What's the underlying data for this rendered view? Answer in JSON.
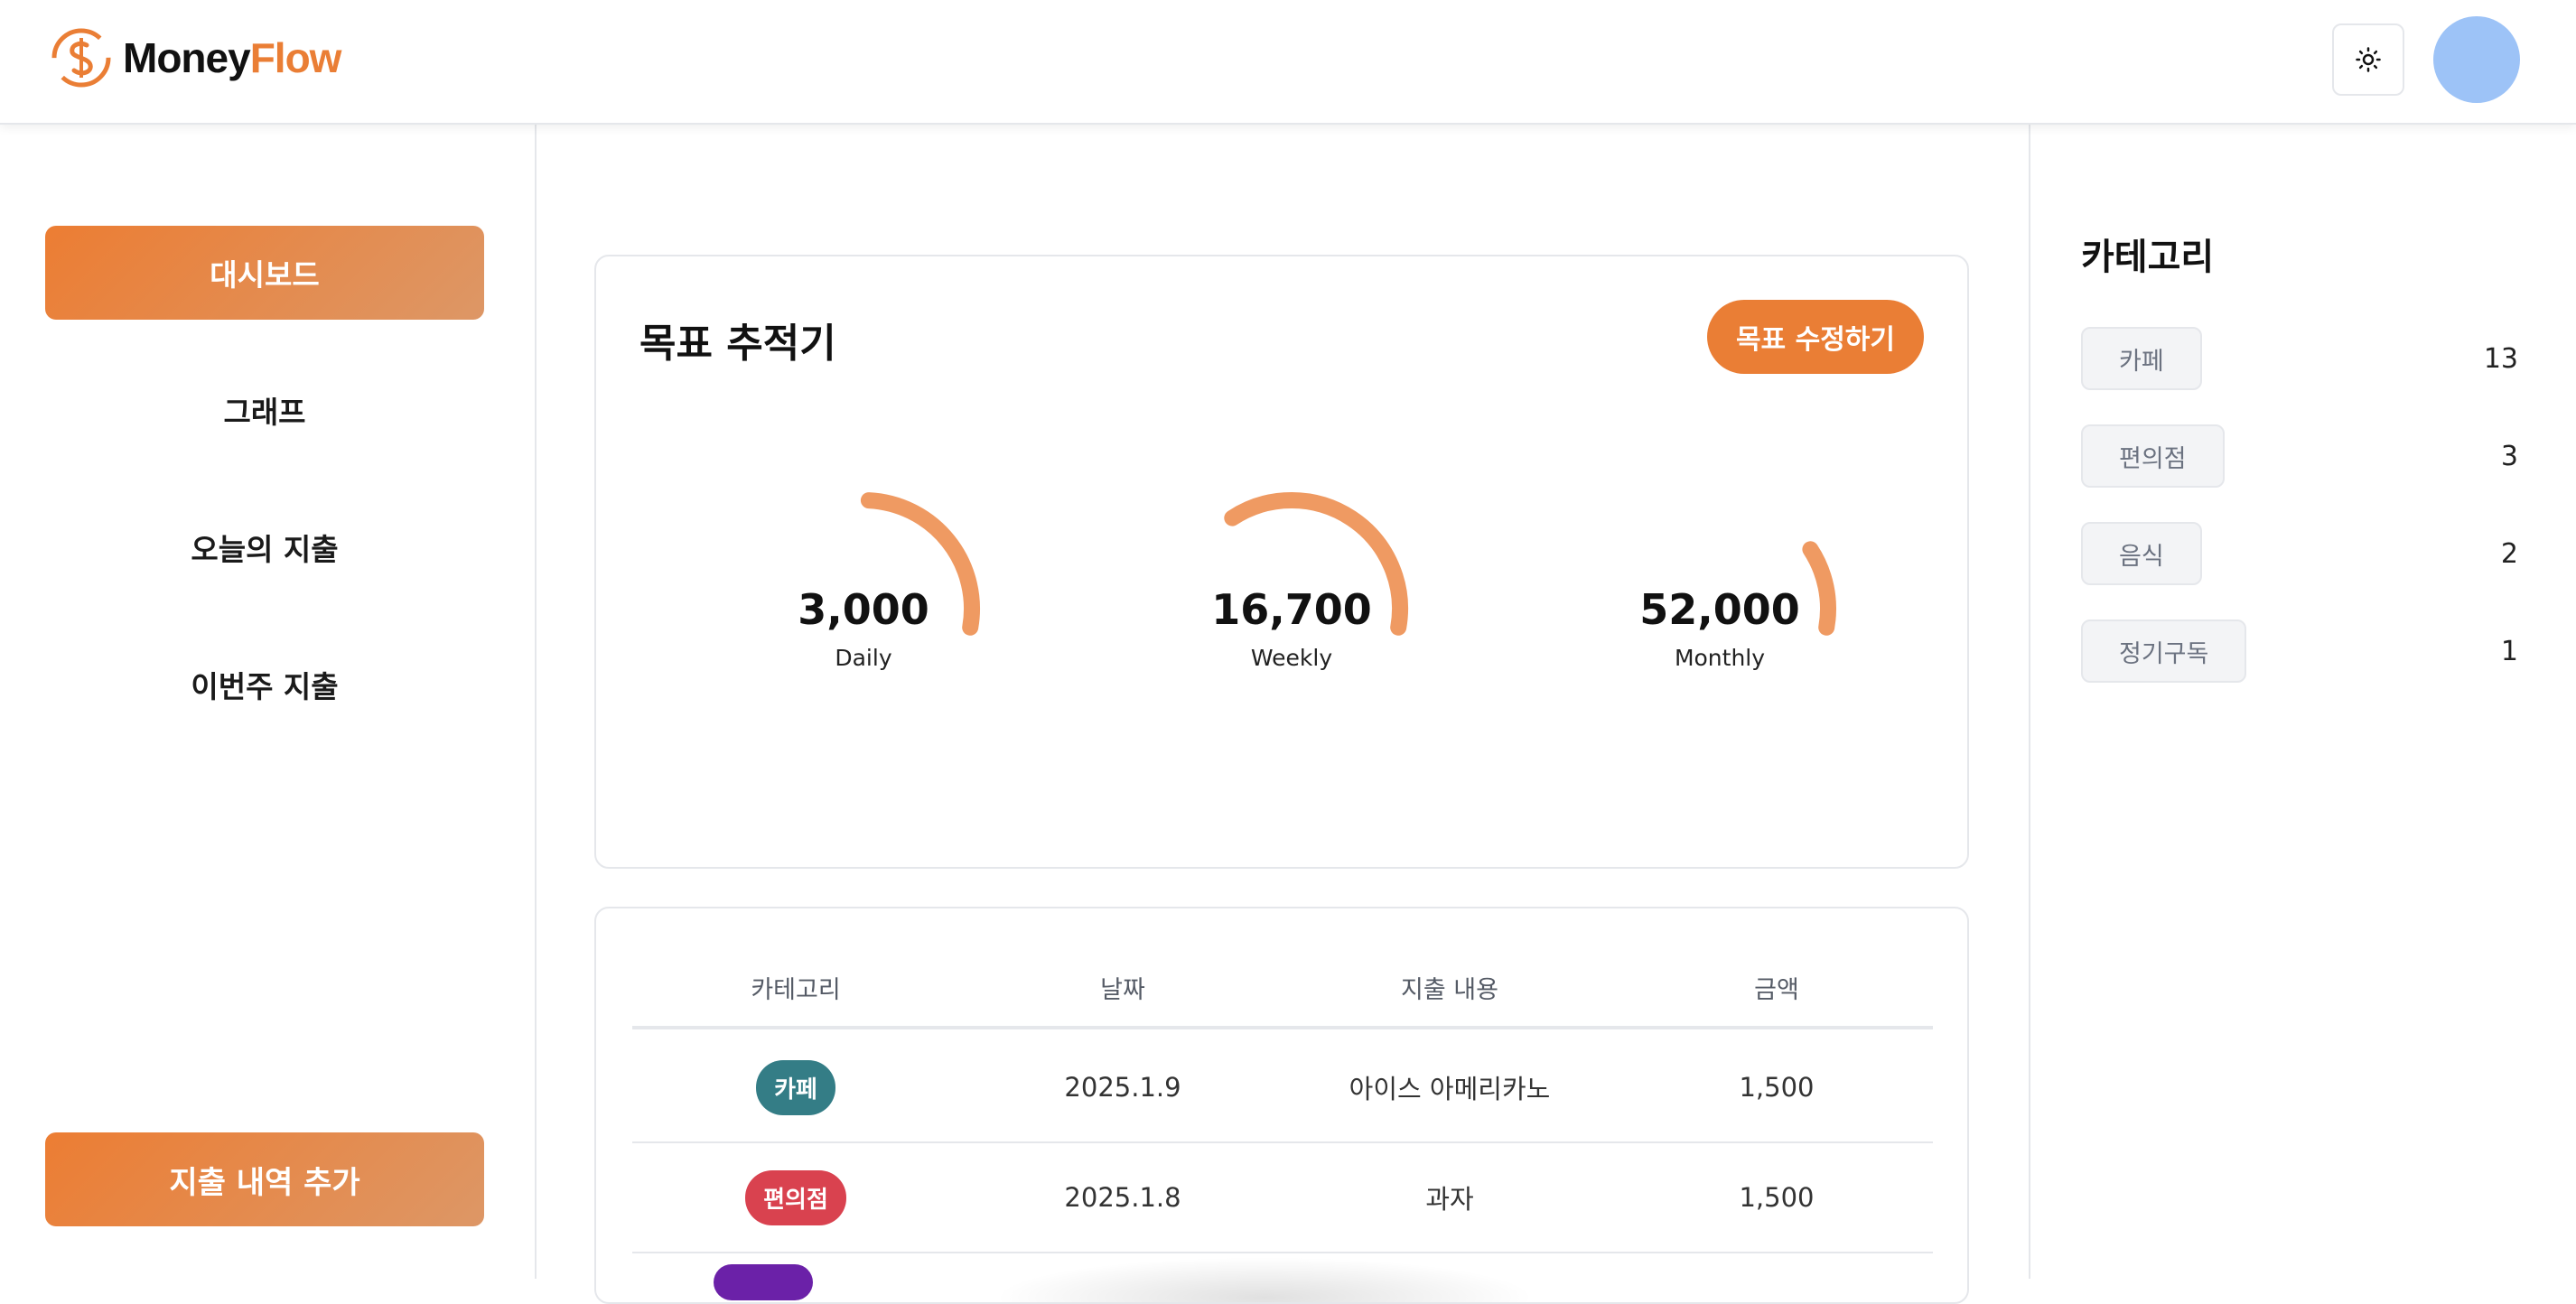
{
  "header": {
    "logo_money": "Money",
    "logo_flow": "Flow",
    "theme_toggle_icon": "sun-icon",
    "avatar_icon": "user-avatar"
  },
  "sidebar": {
    "items": [
      {
        "label": "대시보드",
        "active": true
      },
      {
        "label": "그래프",
        "active": false
      },
      {
        "label": "오늘의 지출",
        "active": false
      },
      {
        "label": "이번주 지출",
        "active": false
      }
    ],
    "add_button": "지출 내역 추가"
  },
  "goal_tracker": {
    "title": "목표 추적기",
    "edit_button": "목표 수정하기",
    "gauges": [
      {
        "value": "3,000",
        "label": "Daily",
        "progress": 0.27
      },
      {
        "value": "16,700",
        "label": "Weekly",
        "progress": 0.37
      },
      {
        "value": "52,000",
        "label": "Monthly",
        "progress": 0.12
      }
    ]
  },
  "expense_table": {
    "headers": [
      "카테고리",
      "날짜",
      "지출 내용",
      "금액"
    ],
    "rows": [
      {
        "category": "카페",
        "category_color": "#347d86",
        "date": "2025.1.9",
        "description": "아이스 아메리카노",
        "amount": "1,500"
      },
      {
        "category": "편의점",
        "category_color": "#d9424f",
        "date": "2025.1.8",
        "description": "과자",
        "amount": "1,500"
      }
    ]
  },
  "categories": {
    "title": "카테고리",
    "items": [
      {
        "label": "카페",
        "count": "13"
      },
      {
        "label": "편의점",
        "count": "3"
      },
      {
        "label": "음식",
        "count": "2"
      },
      {
        "label": "정기구독",
        "count": "1"
      }
    ]
  },
  "colors": {
    "accent": "#ea7e35",
    "gauge_arc": "#ef9a62",
    "avatar": "#9dc3f7"
  }
}
